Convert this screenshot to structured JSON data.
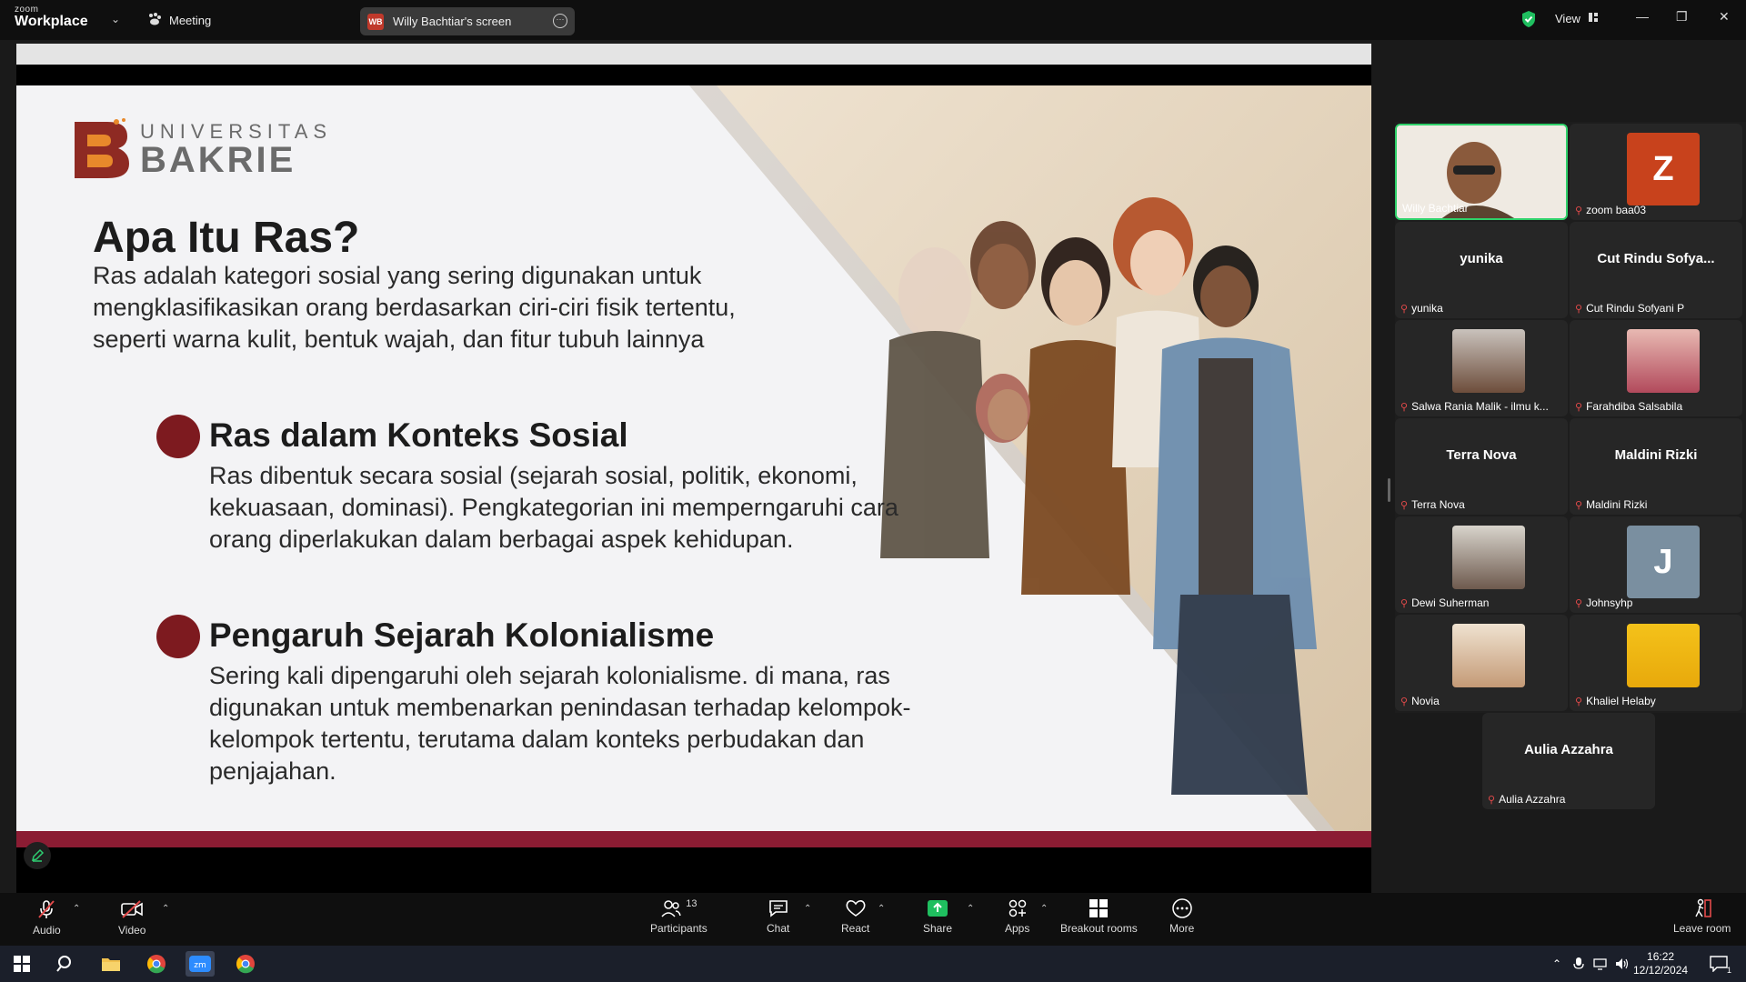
{
  "app": {
    "brand_top": "zoom",
    "brand_name": "Workplace",
    "meeting_label": "Meeting"
  },
  "screen_share": {
    "initials": "WB",
    "label": "Willy Bachtiar's screen"
  },
  "view_label": "View",
  "slide": {
    "logo_top": "UNIVERSITAS",
    "logo_bottom": "BAKRIE",
    "title": "Apa Itu Ras?",
    "intro": "Ras adalah kategori sosial yang sering digunakan untuk mengklasifikasikan orang berdasarkan ciri-ciri fisik tertentu, seperti warna kulit, bentuk wajah, dan fitur tubuh lainnya",
    "points": [
      {
        "heading": "Ras dalam Konteks Sosial",
        "body": "Ras dibentuk secara sosial (sejarah sosial, politik, ekonomi, kekuasaan, dominasi). Pengkategorian ini memperngaruhi cara orang diperlakukan dalam berbagai aspek kehidupan."
      },
      {
        "heading": "Pengaruh Sejarah Kolonialisme",
        "body": "Sering kali dipengaruhi oleh sejarah kolonialisme. di mana, ras digunakan untuk membenarkan penindasan terhadap kelompok-kelompok tertentu, terutama dalam konteks perbudakan dan penjajahan."
      }
    ]
  },
  "participants": [
    {
      "name": "Willy Bachtiar",
      "type": "video"
    },
    {
      "name": "zoom baa03",
      "type": "letter",
      "letter": "Z",
      "color": "#c8421c"
    },
    {
      "name": "yunika",
      "display": "yunika",
      "type": "text"
    },
    {
      "name": "Cut Rindu Sofyani P",
      "display": "Cut Rindu Sofya...",
      "type": "text"
    },
    {
      "name": "Salwa Rania Malik - ilmu k...",
      "type": "photo"
    },
    {
      "name": "Farahdiba Salsabila",
      "type": "photo"
    },
    {
      "name": "Terra Nova",
      "display": "Terra Nova",
      "type": "text"
    },
    {
      "name": "Maldini Rizki",
      "display": "Maldini Rizki",
      "type": "text"
    },
    {
      "name": "Dewi Suherman",
      "type": "photo"
    },
    {
      "name": "Johnsyhp",
      "type": "letter",
      "letter": "J",
      "color": "#7a8fa0"
    },
    {
      "name": "Novia",
      "type": "photo"
    },
    {
      "name": "Khaliel Helaby",
      "type": "photo"
    },
    {
      "name": "Aulia Azzahra",
      "display": "Aulia Azzahra",
      "type": "text"
    }
  ],
  "toolbar": {
    "audio": "Audio",
    "video": "Video",
    "participants": "Participants",
    "participants_count": "13",
    "chat": "Chat",
    "react": "React",
    "share": "Share",
    "apps": "Apps",
    "breakout": "Breakout rooms",
    "more": "More",
    "leave": "Leave room"
  },
  "taskbar": {
    "time": "16:22",
    "date": "12/12/2024",
    "notifications": "1"
  }
}
